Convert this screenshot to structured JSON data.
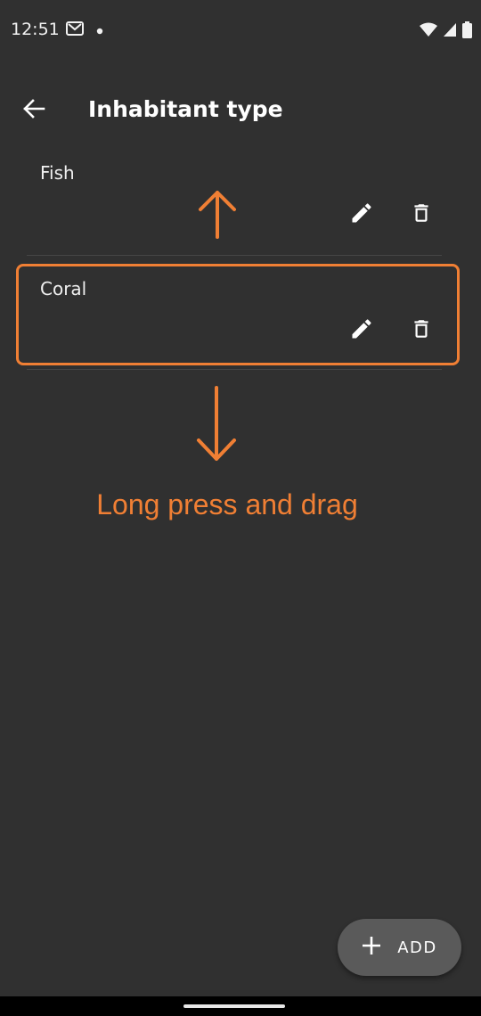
{
  "status_bar": {
    "time": "12:51",
    "left_icons": [
      "gmail-icon",
      "notification-dot-icon"
    ],
    "right_icons": [
      "wifi-icon",
      "signal-icon",
      "battery-icon"
    ]
  },
  "app_bar": {
    "back_icon": "arrow-back-icon",
    "title": "Inhabitant type"
  },
  "items": [
    {
      "label": "Fish",
      "edit_icon": "pencil-icon",
      "delete_icon": "trash-icon"
    },
    {
      "label": "Coral",
      "edit_icon": "pencil-icon",
      "delete_icon": "trash-icon"
    }
  ],
  "annotation": {
    "text": "Long press and drag",
    "color": "#f07f34"
  },
  "fab": {
    "icon": "plus-icon",
    "label": "ADD"
  },
  "colors": {
    "background": "#303030",
    "accent": "#f07f34",
    "fab": "#5a5a5a"
  }
}
